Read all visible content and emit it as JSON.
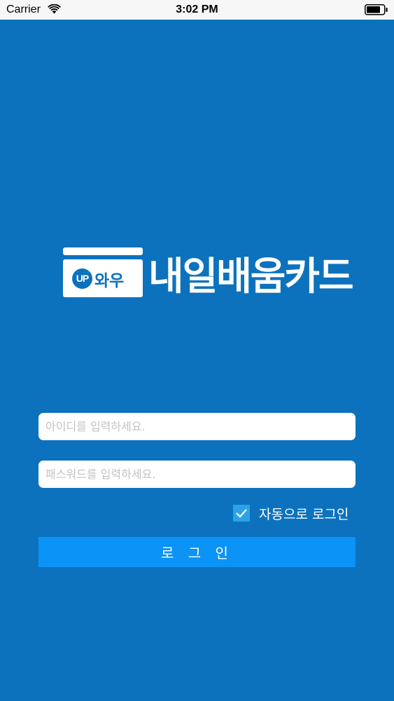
{
  "status_bar": {
    "carrier": "Carrier",
    "time": "3:02 PM",
    "wifi_icon": "wifi-icon",
    "battery_icon": "battery-icon"
  },
  "logo": {
    "badge_text": "UP",
    "sub_text": "와우",
    "brand_text": "내일배움카드"
  },
  "login_form": {
    "id_placeholder": "아이디를 입력하세요.",
    "id_value": "",
    "pw_placeholder": "패스워드를 입력하세요.",
    "pw_value": "",
    "auto_login_label": "자동으로 로그인",
    "auto_login_checked": true,
    "login_button_label": "로 그 인"
  },
  "colors": {
    "background": "#0c72bd",
    "button": "#0b93f6",
    "checkbox": "#2aa3e8"
  }
}
